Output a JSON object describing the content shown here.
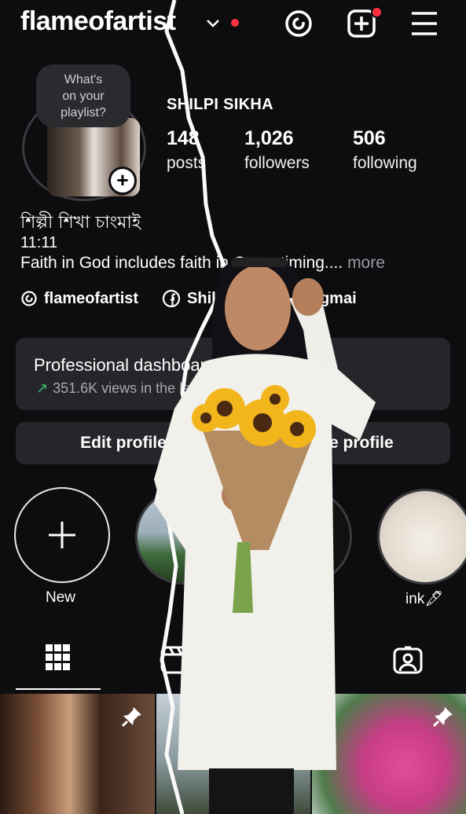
{
  "header": {
    "username": "flameofartist",
    "has_notification": true
  },
  "profile": {
    "note": [
      "What's",
      "on your",
      "playlist?"
    ],
    "display_name": "SHILPI SIKHA",
    "stats": [
      {
        "value": "148",
        "label": "posts"
      },
      {
        "value": "1,026",
        "label": "followers"
      },
      {
        "value": "506",
        "label": "following"
      }
    ],
    "bio_name": "শিল্পী শিখা চাংমাই",
    "bio_time": "11:11",
    "bio_text": "Faith in God includes faith in God's timing....",
    "bio_more": "more",
    "links": {
      "threads": "flameofartist",
      "facebook": "Shilpi Sikha Changmai"
    }
  },
  "dashboard": {
    "title": "Professional dashboard",
    "stat": "351.6K views in the last 30 days."
  },
  "buttons": {
    "edit": "Edit profile",
    "share": "Share profile"
  },
  "highlights": [
    {
      "label": "New"
    },
    {
      "label": ""
    },
    {
      "label": ""
    },
    {
      "label": "ink🖋"
    }
  ],
  "colors": {
    "accent_red": "#ff3040",
    "surface": "#25262a",
    "trend_green": "#3bbf74"
  }
}
